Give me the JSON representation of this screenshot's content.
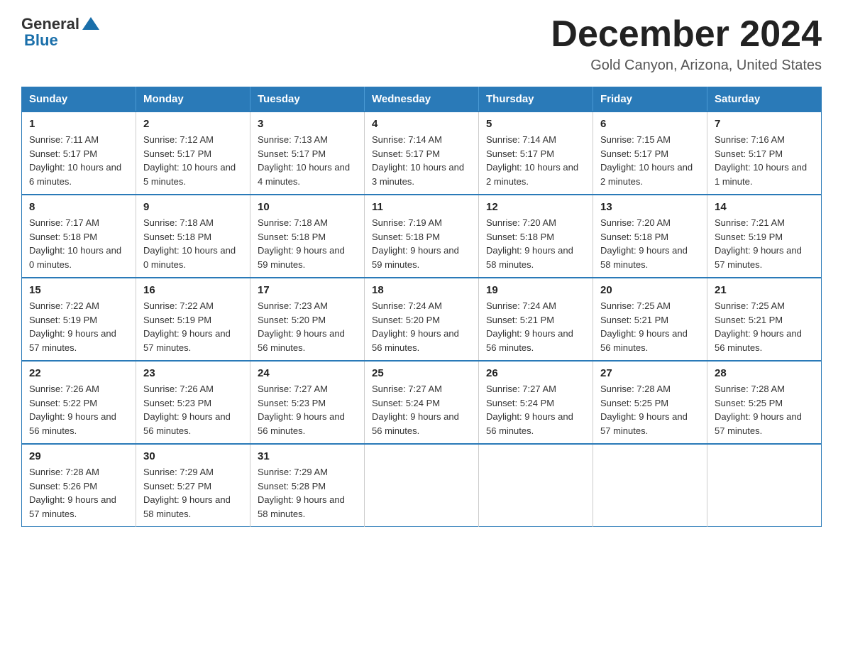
{
  "logo": {
    "text_general": "General",
    "text_blue": "Blue",
    "arrow": "▲"
  },
  "title": "December 2024",
  "subtitle": "Gold Canyon, Arizona, United States",
  "weekdays": [
    "Sunday",
    "Monday",
    "Tuesday",
    "Wednesday",
    "Thursday",
    "Friday",
    "Saturday"
  ],
  "weeks": [
    [
      {
        "day": "1",
        "sunrise": "7:11 AM",
        "sunset": "5:17 PM",
        "daylight": "10 hours and 6 minutes."
      },
      {
        "day": "2",
        "sunrise": "7:12 AM",
        "sunset": "5:17 PM",
        "daylight": "10 hours and 5 minutes."
      },
      {
        "day": "3",
        "sunrise": "7:13 AM",
        "sunset": "5:17 PM",
        "daylight": "10 hours and 4 minutes."
      },
      {
        "day": "4",
        "sunrise": "7:14 AM",
        "sunset": "5:17 PM",
        "daylight": "10 hours and 3 minutes."
      },
      {
        "day": "5",
        "sunrise": "7:14 AM",
        "sunset": "5:17 PM",
        "daylight": "10 hours and 2 minutes."
      },
      {
        "day": "6",
        "sunrise": "7:15 AM",
        "sunset": "5:17 PM",
        "daylight": "10 hours and 2 minutes."
      },
      {
        "day": "7",
        "sunrise": "7:16 AM",
        "sunset": "5:17 PM",
        "daylight": "10 hours and 1 minute."
      }
    ],
    [
      {
        "day": "8",
        "sunrise": "7:17 AM",
        "sunset": "5:18 PM",
        "daylight": "10 hours and 0 minutes."
      },
      {
        "day": "9",
        "sunrise": "7:18 AM",
        "sunset": "5:18 PM",
        "daylight": "10 hours and 0 minutes."
      },
      {
        "day": "10",
        "sunrise": "7:18 AM",
        "sunset": "5:18 PM",
        "daylight": "9 hours and 59 minutes."
      },
      {
        "day": "11",
        "sunrise": "7:19 AM",
        "sunset": "5:18 PM",
        "daylight": "9 hours and 59 minutes."
      },
      {
        "day": "12",
        "sunrise": "7:20 AM",
        "sunset": "5:18 PM",
        "daylight": "9 hours and 58 minutes."
      },
      {
        "day": "13",
        "sunrise": "7:20 AM",
        "sunset": "5:18 PM",
        "daylight": "9 hours and 58 minutes."
      },
      {
        "day": "14",
        "sunrise": "7:21 AM",
        "sunset": "5:19 PM",
        "daylight": "9 hours and 57 minutes."
      }
    ],
    [
      {
        "day": "15",
        "sunrise": "7:22 AM",
        "sunset": "5:19 PM",
        "daylight": "9 hours and 57 minutes."
      },
      {
        "day": "16",
        "sunrise": "7:22 AM",
        "sunset": "5:19 PM",
        "daylight": "9 hours and 57 minutes."
      },
      {
        "day": "17",
        "sunrise": "7:23 AM",
        "sunset": "5:20 PM",
        "daylight": "9 hours and 56 minutes."
      },
      {
        "day": "18",
        "sunrise": "7:24 AM",
        "sunset": "5:20 PM",
        "daylight": "9 hours and 56 minutes."
      },
      {
        "day": "19",
        "sunrise": "7:24 AM",
        "sunset": "5:21 PM",
        "daylight": "9 hours and 56 minutes."
      },
      {
        "day": "20",
        "sunrise": "7:25 AM",
        "sunset": "5:21 PM",
        "daylight": "9 hours and 56 minutes."
      },
      {
        "day": "21",
        "sunrise": "7:25 AM",
        "sunset": "5:21 PM",
        "daylight": "9 hours and 56 minutes."
      }
    ],
    [
      {
        "day": "22",
        "sunrise": "7:26 AM",
        "sunset": "5:22 PM",
        "daylight": "9 hours and 56 minutes."
      },
      {
        "day": "23",
        "sunrise": "7:26 AM",
        "sunset": "5:23 PM",
        "daylight": "9 hours and 56 minutes."
      },
      {
        "day": "24",
        "sunrise": "7:27 AM",
        "sunset": "5:23 PM",
        "daylight": "9 hours and 56 minutes."
      },
      {
        "day": "25",
        "sunrise": "7:27 AM",
        "sunset": "5:24 PM",
        "daylight": "9 hours and 56 minutes."
      },
      {
        "day": "26",
        "sunrise": "7:27 AM",
        "sunset": "5:24 PM",
        "daylight": "9 hours and 56 minutes."
      },
      {
        "day": "27",
        "sunrise": "7:28 AM",
        "sunset": "5:25 PM",
        "daylight": "9 hours and 57 minutes."
      },
      {
        "day": "28",
        "sunrise": "7:28 AM",
        "sunset": "5:25 PM",
        "daylight": "9 hours and 57 minutes."
      }
    ],
    [
      {
        "day": "29",
        "sunrise": "7:28 AM",
        "sunset": "5:26 PM",
        "daylight": "9 hours and 57 minutes."
      },
      {
        "day": "30",
        "sunrise": "7:29 AM",
        "sunset": "5:27 PM",
        "daylight": "9 hours and 58 minutes."
      },
      {
        "day": "31",
        "sunrise": "7:29 AM",
        "sunset": "5:28 PM",
        "daylight": "9 hours and 58 minutes."
      },
      null,
      null,
      null,
      null
    ]
  ]
}
